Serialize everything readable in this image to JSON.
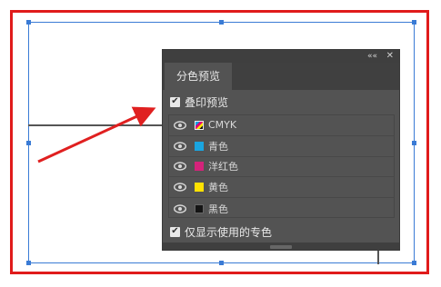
{
  "panel": {
    "tab": "分色预览",
    "collapse_icon": "««",
    "close_icon": "✕",
    "overprint_label": "叠印预览",
    "overprint_checked": true,
    "inks": [
      {
        "label": "CMYK",
        "color": "cmyk"
      },
      {
        "label": "青色",
        "color": "#1aa5e0"
      },
      {
        "label": "洋红色",
        "color": "#d4237a"
      },
      {
        "label": "黄色",
        "color": "#ffe100"
      },
      {
        "label": "黑色",
        "color": "#141414"
      }
    ],
    "spot_only_label": "仅显示使用的专色",
    "spot_only_checked": true
  },
  "annotation": {
    "arrow_color": "#e02020"
  }
}
